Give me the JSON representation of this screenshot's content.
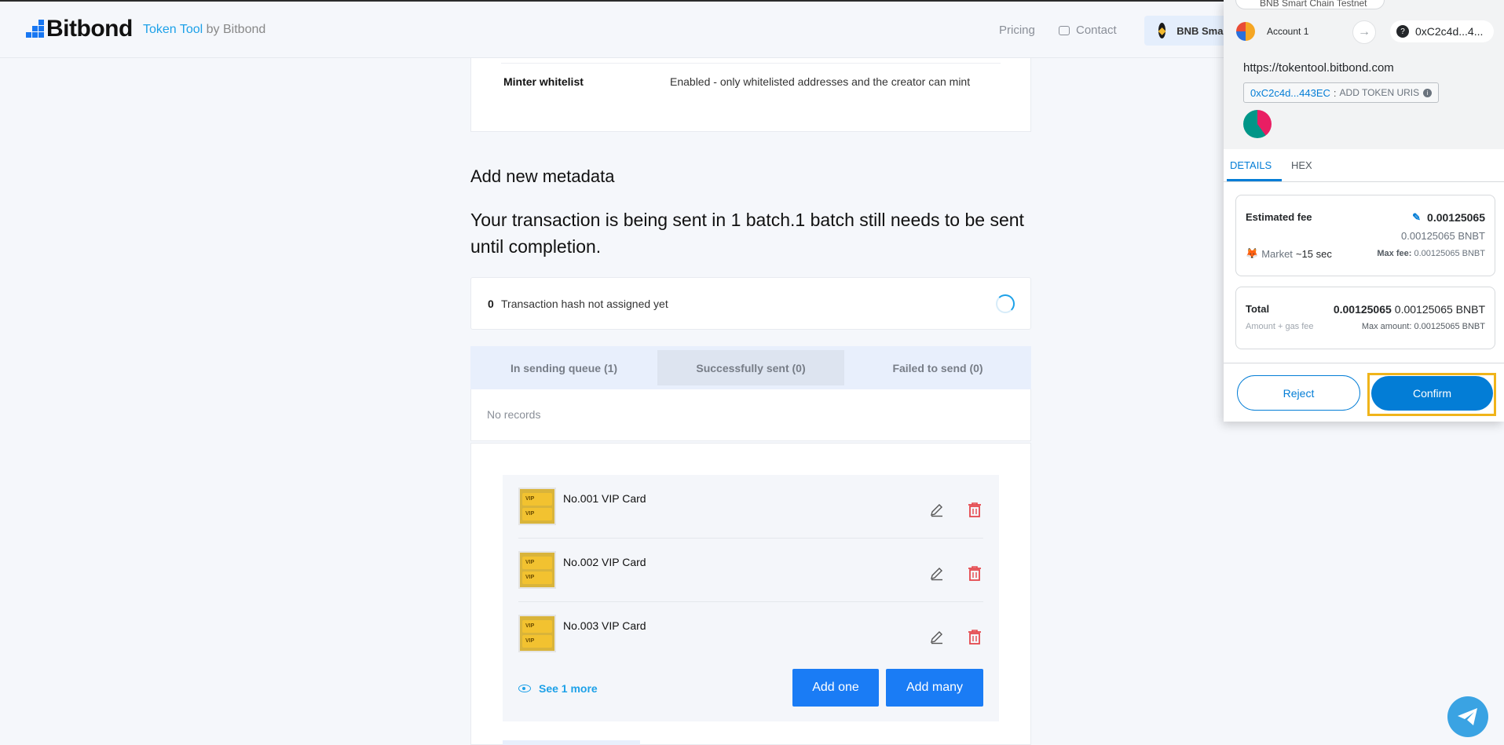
{
  "header": {
    "logo": "Bitbond",
    "tagline_product": "Token Tool",
    "tagline_suffix": " by Bitbond",
    "nav_pricing": "Pricing",
    "nav_contact": "Contact",
    "network": "BNB Smart Chain Testnet"
  },
  "summary": {
    "minter_label": "Minter whitelist",
    "minter_value": "Enabled - only whitelisted addresses and the creator can mint"
  },
  "metadata": {
    "heading": "Add new metadata",
    "batch_message": "Your transaction is being sent in 1 batch.1 batch still needs to be sent until completion.",
    "tx_index": "0",
    "tx_status": "Transaction hash not assigned yet",
    "tabs": [
      {
        "label": "In sending queue (1)"
      },
      {
        "label": "Successfully sent (0)"
      },
      {
        "label": "Failed to send (0)"
      }
    ],
    "no_records": "No records",
    "items": [
      {
        "name": "No.001 VIP Card"
      },
      {
        "name": "No.002 VIP Card"
      },
      {
        "name": "No.003 VIP Card"
      }
    ],
    "thumb_text": "VIP",
    "see_more": "See 1 more",
    "add_one": "Add one",
    "add_many": "Add many"
  },
  "metamask": {
    "network_pill": "BNB Smart Chain Testnet",
    "account": "Account 1",
    "to_address": "0xC2c4d...4...",
    "origin": "https://tokentool.bitbond.com",
    "contract_addr": "0xC2c4d...443EC",
    "method_sep": ":",
    "method": "ADD TOKEN URIS",
    "tab_details": "DETAILS",
    "tab_hex": "HEX",
    "est_fee_label": "Estimated fee",
    "est_fee_value": "0.00125065",
    "est_fee_sub": "0.00125065 BNBT",
    "market_label": "Market",
    "market_time": "~15 sec",
    "max_fee_label": "Max fee:",
    "max_fee_value": "0.00125065 BNBT",
    "total_label": "Total",
    "total_sub": "Amount + gas fee",
    "total_bold": "0.00125065",
    "total_value": "0.00125065 BNBT",
    "max_amount_label": "Max amount:",
    "max_amount_value": "0.00125065 BNBT",
    "reject": "Reject",
    "confirm": "Confirm"
  },
  "colors": {
    "accent": "#1a7cf5",
    "metamask_blue": "#037dd6",
    "highlight": "#f0b41a",
    "danger": "#e5484d"
  }
}
